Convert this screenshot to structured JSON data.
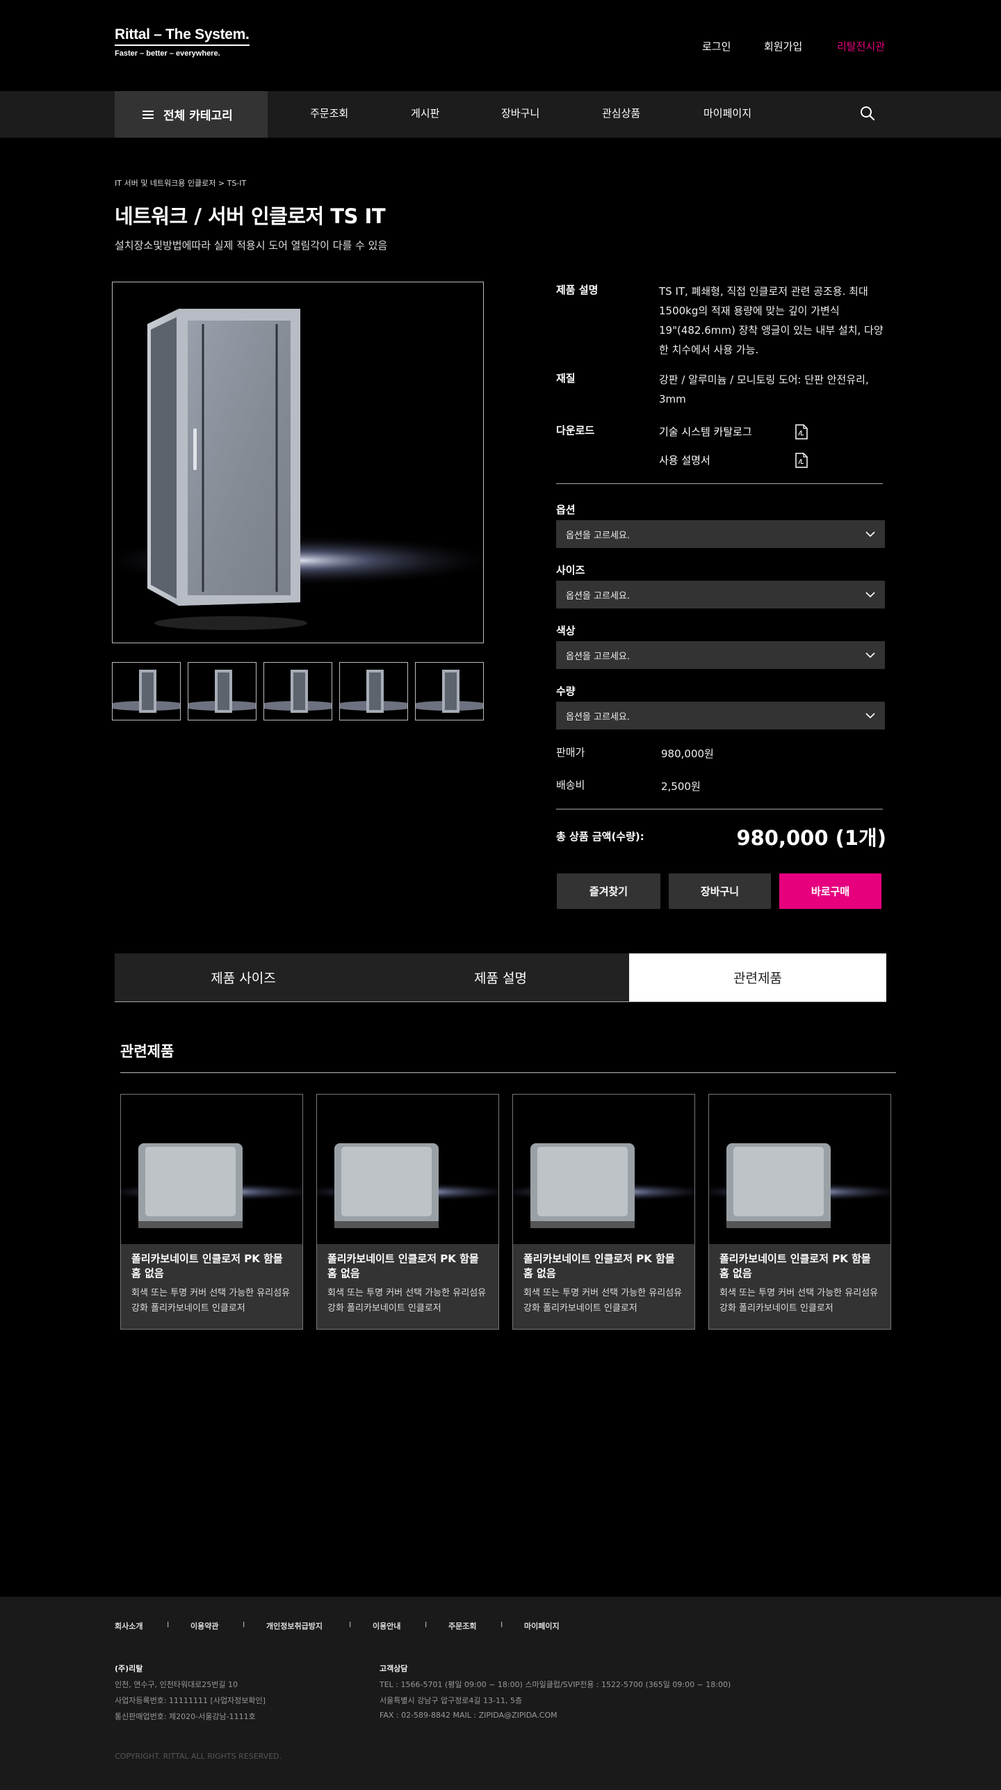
{
  "header": {
    "logo_title": "Rittal – The System.",
    "logo_tagline": "Faster – better – everywhere.",
    "login": "로그인",
    "signup": "회원가입",
    "showroom": "리탈전시관",
    "accent_color": "#e6007e"
  },
  "nav": {
    "all_categories": "전체 카테고리",
    "items": [
      "주문조회",
      "게시판",
      "장바구니",
      "관심상품",
      "마이페이지"
    ],
    "search_icon": "search-icon"
  },
  "product": {
    "breadcrumb": "IT 서버 및 네트워크용 인클로저 > TS-IT",
    "title": "네트워크 / 서버 인클로저 TS IT",
    "subtitle": "설치장소및방법에따라 실제 적용시 도어 열림각이 다를 수 있음",
    "thumbnail_count": 5,
    "desc_label": "제품 설명",
    "desc_lines": [
      "TS IT, 폐쇄형, 직접 인클로저 관련 공조용. 최대",
      "1500kg의 적재 용량에 맞는 깊이 가변식",
      "19\"(482.6mm) 장착 앵글이 있는 내부 설치, 다양",
      "한 치수에서 사용 가능."
    ],
    "material_label": "재질",
    "material_lines": [
      "강판 / 알루미늄 / 모니토링 도어: 단판 안전유리,",
      "3mm"
    ],
    "download_label": "다운로드",
    "downloads": [
      "기술 시스템 카탈로그",
      "사용 설명서"
    ]
  },
  "options": {
    "option_label": "옵션",
    "size_label": "사이즈",
    "color_label": "색상",
    "qty_label": "수량",
    "placeholder": "옵션을 고르세요."
  },
  "pricing": {
    "sale_label": "판매가",
    "sale_value": "980,000원",
    "shipping_label": "배송비",
    "shipping_value": "2,500원",
    "total_label": "총 상품 금액(수량):",
    "total_value": "980,000 (1개)"
  },
  "buttons": {
    "wishlist": "즐겨찾기",
    "cart": "장바구니",
    "buy": "바로구매"
  },
  "tabs": [
    "제품 사이즈",
    "제품 설명",
    "관련제품"
  ],
  "active_tab": "관련제품",
  "related": {
    "title": "관련제품",
    "items": [
      {
        "name": "폴리카보네이트 인클로저 PK 함몰 홈 없음",
        "desc": "회색 또는 투명 커버 선택 가능한 유리섬유 강화 폴리카보네이트 인클로저"
      },
      {
        "name": "폴리카보네이트 인클로저 PK 함몰 홈 없음",
        "desc": "회색 또는 투명 커버 선택 가능한 유리섬유 강화 폴리카보네이트 인클로저"
      },
      {
        "name": "폴리카보네이트 인클로저 PK 함몰 홈 없음",
        "desc": "회색 또는 투명 커버 선택 가능한 유리섬유 강화 폴리카보네이트 인클로저"
      },
      {
        "name": "폴리카보네이트 인클로저 PK 함몰 홈 없음",
        "desc": "회색 또는 투명 커버 선택 가능한 유리섬유 강화 폴리카보네이트 인클로저"
      }
    ]
  },
  "footer": {
    "links": [
      "회사소개",
      "이용약관",
      "개인정보취급방지",
      "이용안내",
      "주문조회",
      "마이페이지"
    ],
    "company_head": "(주)리탈",
    "company_lines": [
      "인천, 연수구, 인천타워대로25번길 10",
      "사업자등록번호: 11111111 [사업자정보확인]",
      "통신판매업번호: 제2020-서울강남-1111호"
    ],
    "cs_head": "고객상담",
    "cs_lines": [
      "TEL : 1566-5701 (평일 09:00 ~ 18:00)   스마일클럽/SVIP전용 : 1522-5700 (365일 09:00 ~ 18:00)",
      "서울특별시 강남구 압구정로4길 13-11, 5층",
      "FAX : 02-589-8842   MAIL : ZIPIDA@ZIPIDA.COM"
    ],
    "copyright": "COPYRIGHT. RITTAL ALL RIGHTS RESERVED."
  }
}
